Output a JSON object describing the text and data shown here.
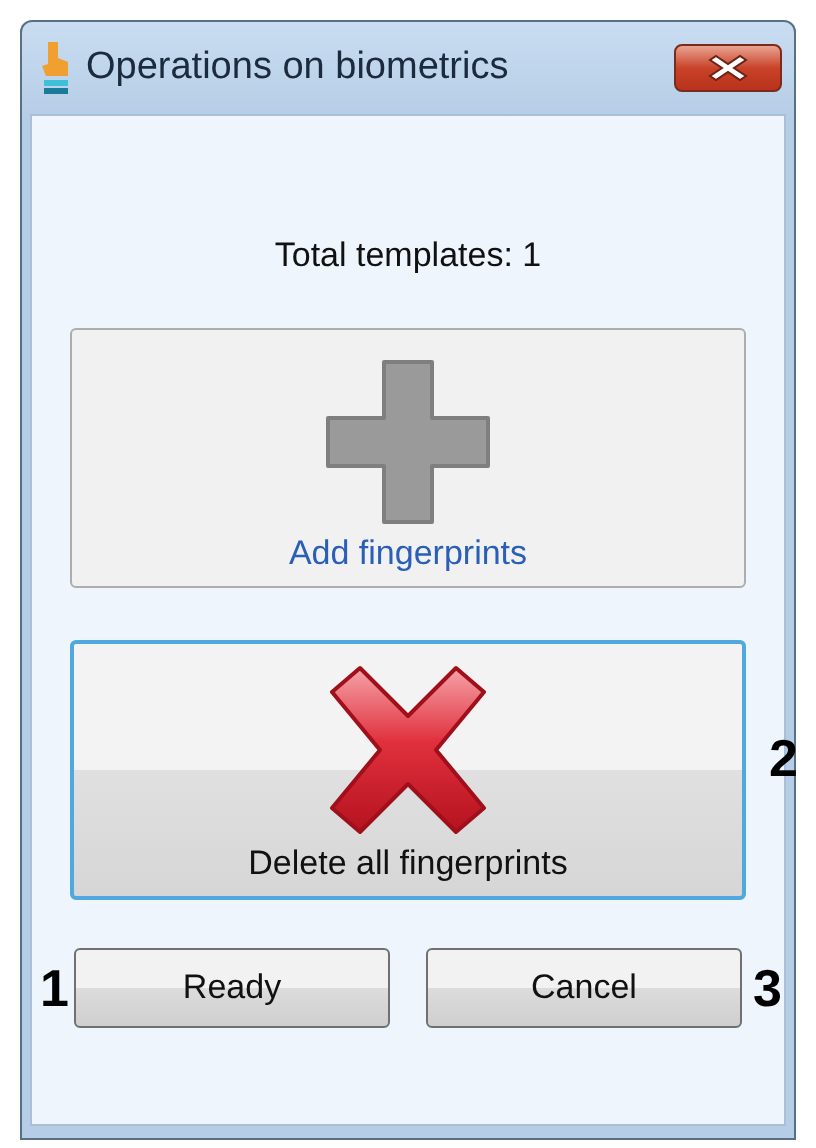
{
  "window": {
    "title": "Operations on biometrics"
  },
  "summary": "Total templates: 1",
  "actions": [
    {
      "kind": "add",
      "label": "Add fingerprints",
      "focused": false
    },
    {
      "kind": "delete",
      "label": "Delete all fingerprints",
      "focused": true,
      "callout": "2"
    }
  ],
  "buttons": [
    {
      "label": "Ready",
      "callout": "1"
    },
    {
      "label": "Cancel",
      "callout": "3"
    }
  ]
}
